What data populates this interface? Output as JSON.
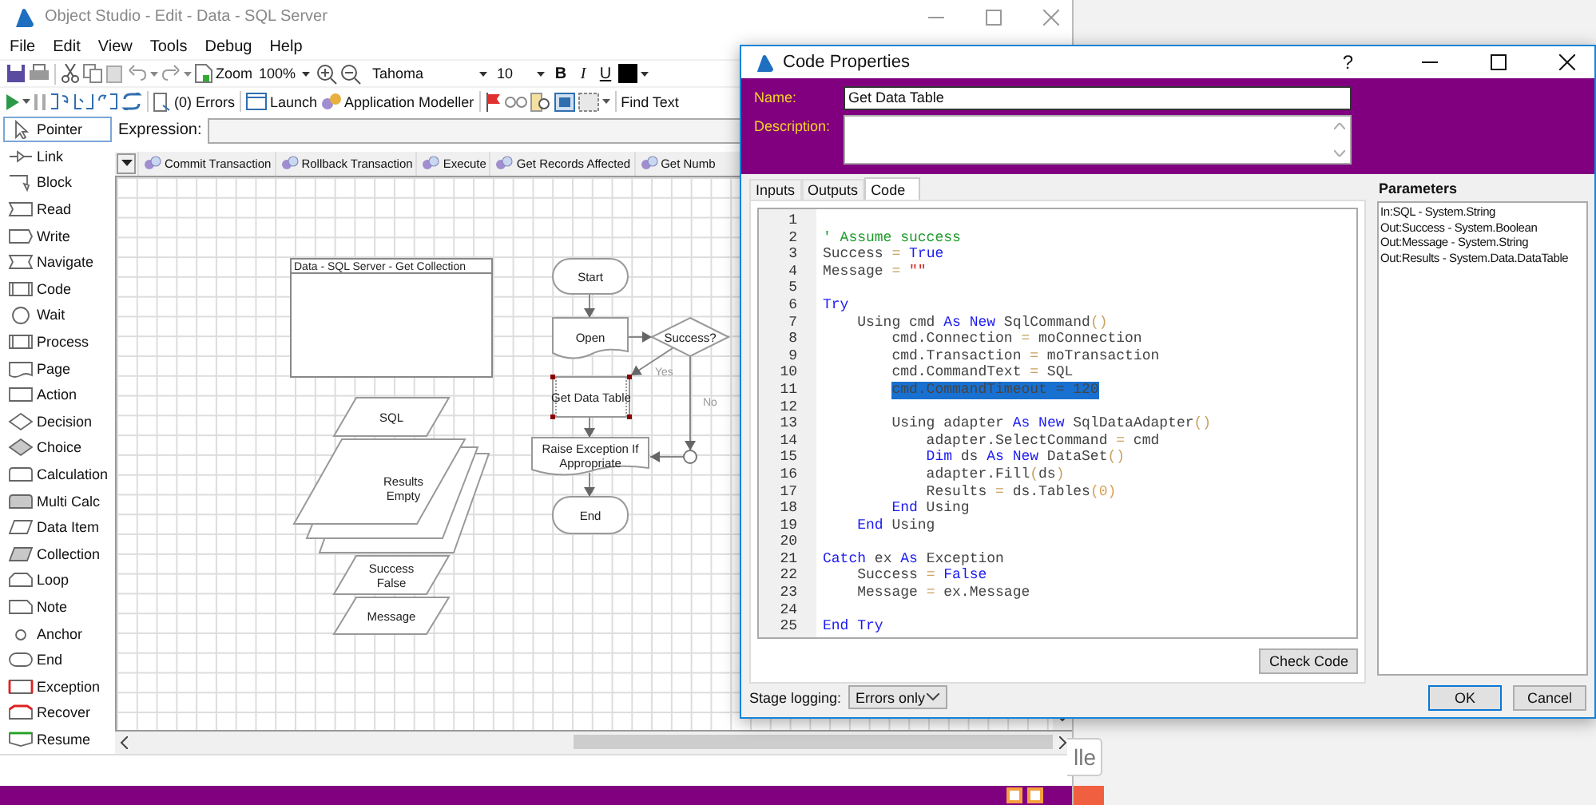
{
  "main_window": {
    "title": "Object Studio - Edit - Data - SQL Server",
    "menu": [
      "File",
      "Edit",
      "View",
      "Tools",
      "Debug",
      "Help"
    ],
    "toolbar": {
      "zoom_label": "Zoom",
      "zoom_value": "100%",
      "font": "Tahoma",
      "font_size": "10",
      "bold": "B",
      "italic": "I",
      "underline": "U"
    },
    "debug_toolbar": {
      "errors": "(0) Errors",
      "launch": "Launch",
      "app_modeller": "Application Modeller",
      "find": "Find Text"
    },
    "palette": [
      {
        "kind": "pointer",
        "label": "Pointer",
        "selected": true
      },
      {
        "kind": "link",
        "label": "Link",
        "selected": false
      },
      {
        "kind": "block",
        "label": "Block",
        "selected": false
      },
      {
        "kind": "read",
        "label": "Read",
        "selected": false
      },
      {
        "kind": "write",
        "label": "Write",
        "selected": false
      },
      {
        "kind": "navigate",
        "label": "Navigate",
        "selected": false
      },
      {
        "kind": "code",
        "label": "Code",
        "selected": false
      },
      {
        "kind": "wait",
        "label": "Wait",
        "selected": false
      },
      {
        "kind": "process",
        "label": "Process",
        "selected": false
      },
      {
        "kind": "page",
        "label": "Page",
        "selected": false
      },
      {
        "kind": "action",
        "label": "Action",
        "selected": false
      },
      {
        "kind": "decision",
        "label": "Decision",
        "selected": false
      },
      {
        "kind": "choice",
        "label": "Choice",
        "selected": false
      },
      {
        "kind": "calculation",
        "label": "Calculation",
        "selected": false
      },
      {
        "kind": "multicalc",
        "label": "Multi Calc",
        "selected": false
      },
      {
        "kind": "dataitem",
        "label": "Data Item",
        "selected": false
      },
      {
        "kind": "collection",
        "label": "Collection",
        "selected": false
      },
      {
        "kind": "loop",
        "label": "Loop",
        "selected": false
      },
      {
        "kind": "note",
        "label": "Note",
        "selected": false
      },
      {
        "kind": "anchor",
        "label": "Anchor",
        "selected": false
      },
      {
        "kind": "end",
        "label": "End",
        "selected": false
      },
      {
        "kind": "exception",
        "label": "Exception",
        "selected": false
      },
      {
        "kind": "recover",
        "label": "Recover",
        "selected": false
      },
      {
        "kind": "resume",
        "label": "Resume",
        "selected": false
      }
    ],
    "expression_label": "Expression:",
    "action_tabs": [
      "Commit Transaction",
      "Rollback Transaction",
      "Execute",
      "Get Records Affected",
      "Get Numb"
    ],
    "stages": [
      {
        "kind": "block",
        "lines": [
          "Data - SQL Server - Get Collection"
        ],
        "selected": false
      },
      {
        "kind": "data",
        "lines": [
          "SQL"
        ],
        "selected": false
      },
      {
        "kind": "collection",
        "lines": [
          "Results",
          "Empty"
        ],
        "selected": false
      },
      {
        "kind": "data",
        "lines": [
          "Success",
          "False"
        ],
        "selected": false
      },
      {
        "kind": "data",
        "lines": [
          "Message"
        ],
        "selected": false
      },
      {
        "kind": "start",
        "lines": [
          "Start"
        ],
        "selected": false
      },
      {
        "kind": "page",
        "lines": [
          "Open"
        ],
        "selected": false
      },
      {
        "kind": "decision",
        "lines": [
          "Success?"
        ],
        "selected": false
      },
      {
        "kind": "code",
        "lines": [
          "Get Data Table"
        ],
        "selected": true
      },
      {
        "kind": "page",
        "lines": [
          "Raise Exception If",
          "Appropriate"
        ],
        "selected": false
      },
      {
        "kind": "anchor",
        "selected": false
      },
      {
        "kind": "end",
        "lines": [
          "End"
        ],
        "selected": false
      }
    ],
    "link_labels": [
      "Yes",
      "No"
    ]
  },
  "background_button": {
    "label": "lle"
  },
  "dialog": {
    "title": "Code Properties",
    "help": "?",
    "name_label": "Name:",
    "name_value": "Get Data Table",
    "description_label": "Description:",
    "tabs": [
      {
        "label": "Inputs",
        "selected": false
      },
      {
        "label": "Outputs",
        "selected": false
      },
      {
        "label": "Code",
        "selected": true
      }
    ],
    "code_lines": [
      {
        "no": "1",
        "selected": false
      },
      {
        "no": "2",
        "selected": false,
        "segments": [
          {
            "text": "' Assume success",
            "kind": "comment"
          }
        ]
      },
      {
        "no": "3",
        "selected": false,
        "segments": [
          {
            "text": "Success ",
            "kind": "plain"
          },
          {
            "text": "=",
            "kind": "operator"
          },
          {
            "text": " True",
            "kind": "keyword"
          }
        ]
      },
      {
        "no": "4",
        "selected": false,
        "segments": [
          {
            "text": "Message ",
            "kind": "plain"
          },
          {
            "text": "=",
            "kind": "operator"
          },
          {
            "text": " \"\"",
            "kind": "string"
          }
        ]
      },
      {
        "no": "5",
        "selected": false
      },
      {
        "no": "6",
        "selected": false,
        "segments": [
          {
            "text": "Try",
            "kind": "keyword"
          }
        ],
        "children": [
          {
            "no": "7",
            "selected": false,
            "segments": [
              {
                "text": "Using cmd ",
                "kind": "plain"
              },
              {
                "text": "As",
                "kind": "keyword"
              },
              {
                "text": " New",
                "kind": "keyword"
              },
              {
                "text": " SqlCommand",
                "kind": "plain"
              },
              {
                "text": "()",
                "kind": "operator"
              }
            ],
            "children": [
              {
                "no": "8",
                "selected": false,
                "segments": [
                  {
                    "text": "cmd.Connection ",
                    "kind": "plain"
                  },
                  {
                    "text": "=",
                    "kind": "operator"
                  },
                  {
                    "text": " moConnection",
                    "kind": "plain"
                  }
                ]
              },
              {
                "no": "9",
                "selected": false,
                "segments": [
                  {
                    "text": "cmd.Transaction ",
                    "kind": "plain"
                  },
                  {
                    "text": "=",
                    "kind": "operator"
                  },
                  {
                    "text": " moTransaction",
                    "kind": "plain"
                  }
                ]
              },
              {
                "no": "10",
                "selected": false,
                "segments": [
                  {
                    "text": "cmd.CommandText ",
                    "kind": "plain"
                  },
                  {
                    "text": "=",
                    "kind": "operator"
                  },
                  {
                    "text": " SQL",
                    "kind": "plain"
                  }
                ]
              },
              {
                "no": "11",
                "selected": true,
                "segments": [
                  {
                    "text": "cmd.CommandTimeout = 120",
                    "kind": "plain"
                  }
                ]
              },
              {
                "no": "12",
                "selected": false
              },
              {
                "no": "13",
                "selected": false,
                "segments": [
                  {
                    "text": "Using adapter ",
                    "kind": "plain"
                  },
                  {
                    "text": "As",
                    "kind": "keyword"
                  },
                  {
                    "text": " New",
                    "kind": "keyword"
                  },
                  {
                    "text": " SqlDataAdapter",
                    "kind": "plain"
                  },
                  {
                    "text": "()",
                    "kind": "operator"
                  }
                ],
                "children": [
                  {
                    "no": "14",
                    "selected": false,
                    "segments": [
                      {
                        "text": "adapter.SelectCommand ",
                        "kind": "plain"
                      },
                      {
                        "text": "=",
                        "kind": "operator"
                      },
                      {
                        "text": " cmd",
                        "kind": "plain"
                      }
                    ]
                  },
                  {
                    "no": "15",
                    "selected": false,
                    "segments": [
                      {
                        "text": "Dim",
                        "kind": "keyword"
                      },
                      {
                        "text": " ds ",
                        "kind": "plain"
                      },
                      {
                        "text": "As",
                        "kind": "keyword"
                      },
                      {
                        "text": " New",
                        "kind": "keyword"
                      },
                      {
                        "text": " DataSet",
                        "kind": "plain"
                      },
                      {
                        "text": "()",
                        "kind": "operator"
                      }
                    ]
                  },
                  {
                    "no": "16",
                    "selected": false,
                    "segments": [
                      {
                        "text": "adapter.Fill",
                        "kind": "plain"
                      },
                      {
                        "text": "(",
                        "kind": "operator"
                      },
                      {
                        "text": "ds",
                        "kind": "plain"
                      },
                      {
                        "text": ")",
                        "kind": "operator"
                      }
                    ]
                  },
                  {
                    "no": "17",
                    "selected": false,
                    "segments": [
                      {
                        "text": "Results ",
                        "kind": "plain"
                      },
                      {
                        "text": "=",
                        "kind": "operator"
                      },
                      {
                        "text": " ds.Tables",
                        "kind": "plain"
                      },
                      {
                        "text": "(0)",
                        "kind": "number"
                      }
                    ]
                  }
                ]
              },
              {
                "no": "18",
                "selected": false,
                "segments": [
                  {
                    "text": "End",
                    "kind": "keyword"
                  },
                  {
                    "text": " Using",
                    "kind": "plain"
                  }
                ]
              }
            ]
          },
          {
            "no": "19",
            "selected": false,
            "segments": [
              {
                "text": "End",
                "kind": "keyword"
              },
              {
                "text": " Using",
                "kind": "plain"
              }
            ]
          }
        ]
      },
      {
        "no": "20",
        "selected": false
      },
      {
        "no": "21",
        "selected": false,
        "segments": [
          {
            "text": "Catch",
            "kind": "keyword"
          },
          {
            "text": " ex ",
            "kind": "plain"
          },
          {
            "text": "As",
            "kind": "keyword"
          },
          {
            "text": " Exception",
            "kind": "plain"
          }
        ],
        "children": [
          {
            "no": "22",
            "selected": false,
            "segments": [
              {
                "text": "Success ",
                "kind": "plain"
              },
              {
                "text": "=",
                "kind": "operator"
              },
              {
                "text": " False",
                "kind": "keyword"
              }
            ]
          },
          {
            "no": "23",
            "selected": false,
            "segments": [
              {
                "text": "Message ",
                "kind": "plain"
              },
              {
                "text": "=",
                "kind": "operator"
              },
              {
                "text": " ex.Message",
                "kind": "plain"
              }
            ]
          }
        ]
      },
      {
        "no": "24",
        "selected": false
      },
      {
        "no": "25",
        "selected": false,
        "segments": [
          {
            "text": "End Try",
            "kind": "keyword"
          }
        ]
      }
    ],
    "check_button": "Check Code",
    "parameters_title": "Parameters",
    "parameters": [
      "In:SQL - System.String",
      "Out:Success - System.Boolean",
      "Out:Message - System.String",
      "Out:Results - System.Data.DataTable"
    ],
    "stage_logging_label": "Stage logging:",
    "stage_logging_value": "Errors only",
    "buttons": [
      {
        "label": "OK",
        "kind": "default"
      },
      {
        "label": "Cancel",
        "kind": "normal"
      }
    ]
  }
}
